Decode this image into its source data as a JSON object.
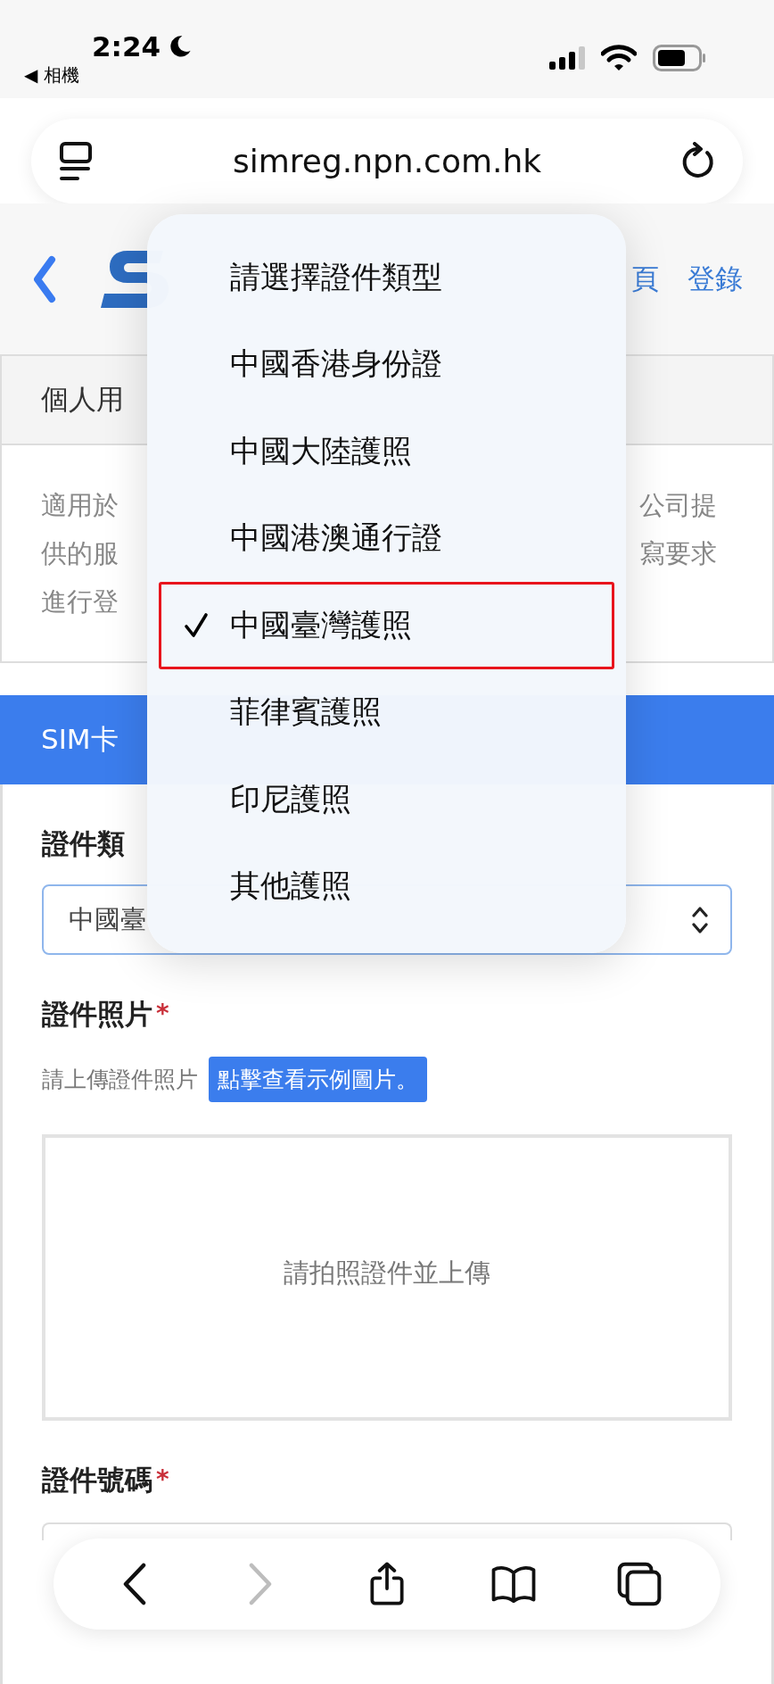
{
  "status_bar": {
    "time": "2:24",
    "back_app": "◀ 相機"
  },
  "address_bar": {
    "url": "simreg.npn.com.hk"
  },
  "header": {
    "links": [
      "頁",
      "登錄"
    ]
  },
  "notice_card": {
    "title": "個人用",
    "lines": [
      {
        "left": "適用於",
        "right": "公司提"
      },
      {
        "left": "供的服",
        "right": "寫要求"
      },
      {
        "left": "進行登"
      }
    ]
  },
  "form_section": {
    "title": "SIM卡"
  },
  "id_type": {
    "label": "證件類",
    "value": "中國臺"
  },
  "id_photo": {
    "label": "證件照片",
    "required_mark": "*",
    "hint": "請上傳證件照片",
    "sample_link": "點擊查看示例圖片。",
    "upload_text": "請拍照證件並上傳"
  },
  "id_number": {
    "label": "證件號碼",
    "required_mark": "*"
  },
  "dropdown": {
    "options": [
      {
        "label": "請選擇證件類型",
        "selected": false,
        "outlined": false
      },
      {
        "label": "中國香港身份證",
        "selected": false,
        "outlined": false
      },
      {
        "label": "中國大陸護照",
        "selected": false,
        "outlined": false
      },
      {
        "label": "中國港澳通行證",
        "selected": false,
        "outlined": false
      },
      {
        "label": "中國臺灣護照",
        "selected": true,
        "outlined": true
      },
      {
        "label": "菲律賓護照",
        "selected": false,
        "outlined": false
      },
      {
        "label": "印尼護照",
        "selected": false,
        "outlined": false
      },
      {
        "label": "其他護照",
        "selected": false,
        "outlined": false
      }
    ]
  },
  "toolbar": {
    "buttons": [
      {
        "kind": "back",
        "disabled": false
      },
      {
        "kind": "forward",
        "disabled": true
      },
      {
        "kind": "share",
        "disabled": false
      },
      {
        "kind": "bookmarks",
        "disabled": false
      },
      {
        "kind": "tabs",
        "disabled": false
      }
    ]
  }
}
